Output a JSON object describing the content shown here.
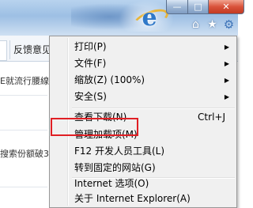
{
  "window": {
    "caption_min": "—",
    "caption_max": "□",
    "caption_close": "✕"
  },
  "toolbar": {
    "home_icon": "home-icon",
    "favorites_icon": "star-icon",
    "tools_icon": "gear-icon"
  },
  "tabs": {
    "feedback_label": "反馈意见"
  },
  "page": {
    "text_line1": "E就流行腰線彡",
    "text_line2": "搜索份额破30"
  },
  "menu": {
    "items": [
      {
        "label": "打印(P)",
        "submenu": true
      },
      {
        "label": "文件(F)",
        "submenu": true
      },
      {
        "label": "缩放(Z) (100%)",
        "submenu": true
      },
      {
        "label": "安全(S)",
        "submenu": true
      },
      {
        "label": "查看下载(N)",
        "shortcut": "Ctrl+J"
      },
      {
        "label": "管理加载项(M)",
        "highlighted": true
      },
      {
        "label": "F12 开发人员工具(L)"
      },
      {
        "label": "转到固定的网站(G)"
      },
      {
        "label": "Internet 选项(O)"
      },
      {
        "label": "关于 Internet Explorer(A)"
      }
    ]
  },
  "colors": {
    "highlight_border": "#e01f24",
    "menu_bg": "#f0f0f0"
  }
}
